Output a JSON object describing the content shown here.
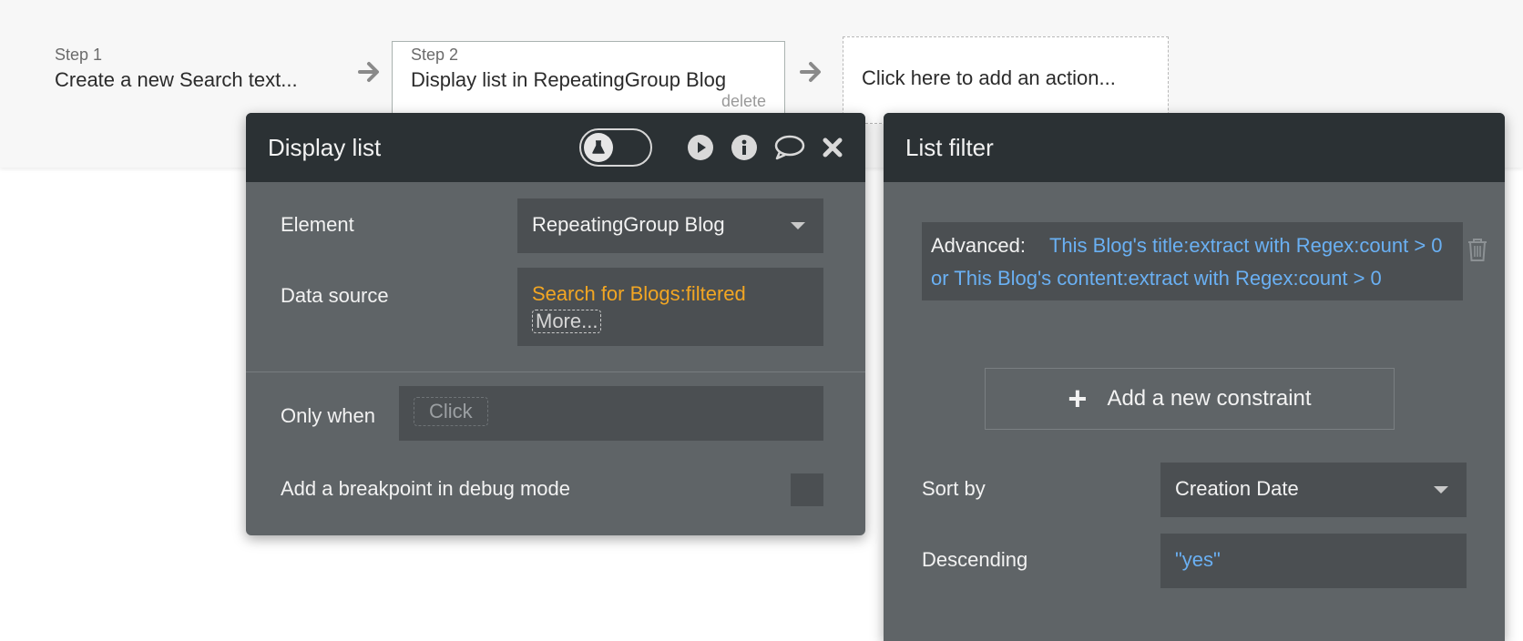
{
  "workflow": {
    "step1": {
      "label": "Step 1",
      "title": "Create a new Search text..."
    },
    "step2": {
      "label": "Step 2",
      "title": "Display list in RepeatingGroup Blog",
      "delete_label": "delete"
    },
    "add_action": "Click here to add an action..."
  },
  "display_list": {
    "title": "Display list",
    "icons": [
      "flask-icon",
      "play-icon",
      "info-icon",
      "comment-icon",
      "close-icon"
    ],
    "element": {
      "label": "Element",
      "value": "RepeatingGroup Blog"
    },
    "data_source": {
      "label": "Data source",
      "value": "Search for Blogs:filtered",
      "more": "More..."
    },
    "only_when": {
      "label": "Only when",
      "placeholder": "Click"
    },
    "breakpoint": {
      "label": "Add a breakpoint in debug mode"
    }
  },
  "list_filter": {
    "title": "List filter",
    "advanced": {
      "label": "Advanced:",
      "expression": "This Blog's title:extract with Regex:count > 0 or This Blog's content:extract with Regex:count > 0"
    },
    "add_constraint": "Add a new constraint",
    "sort_by": {
      "label": "Sort by",
      "value": "Creation Date"
    },
    "descending": {
      "label": "Descending",
      "value": "\"yes\""
    }
  },
  "colors": {
    "panel_header": "#2b3134",
    "panel_body": "#5f6467",
    "field_bg": "#4b4f52",
    "orange_expression": "#f2a623",
    "blue_expression": "#6ab0f3"
  }
}
